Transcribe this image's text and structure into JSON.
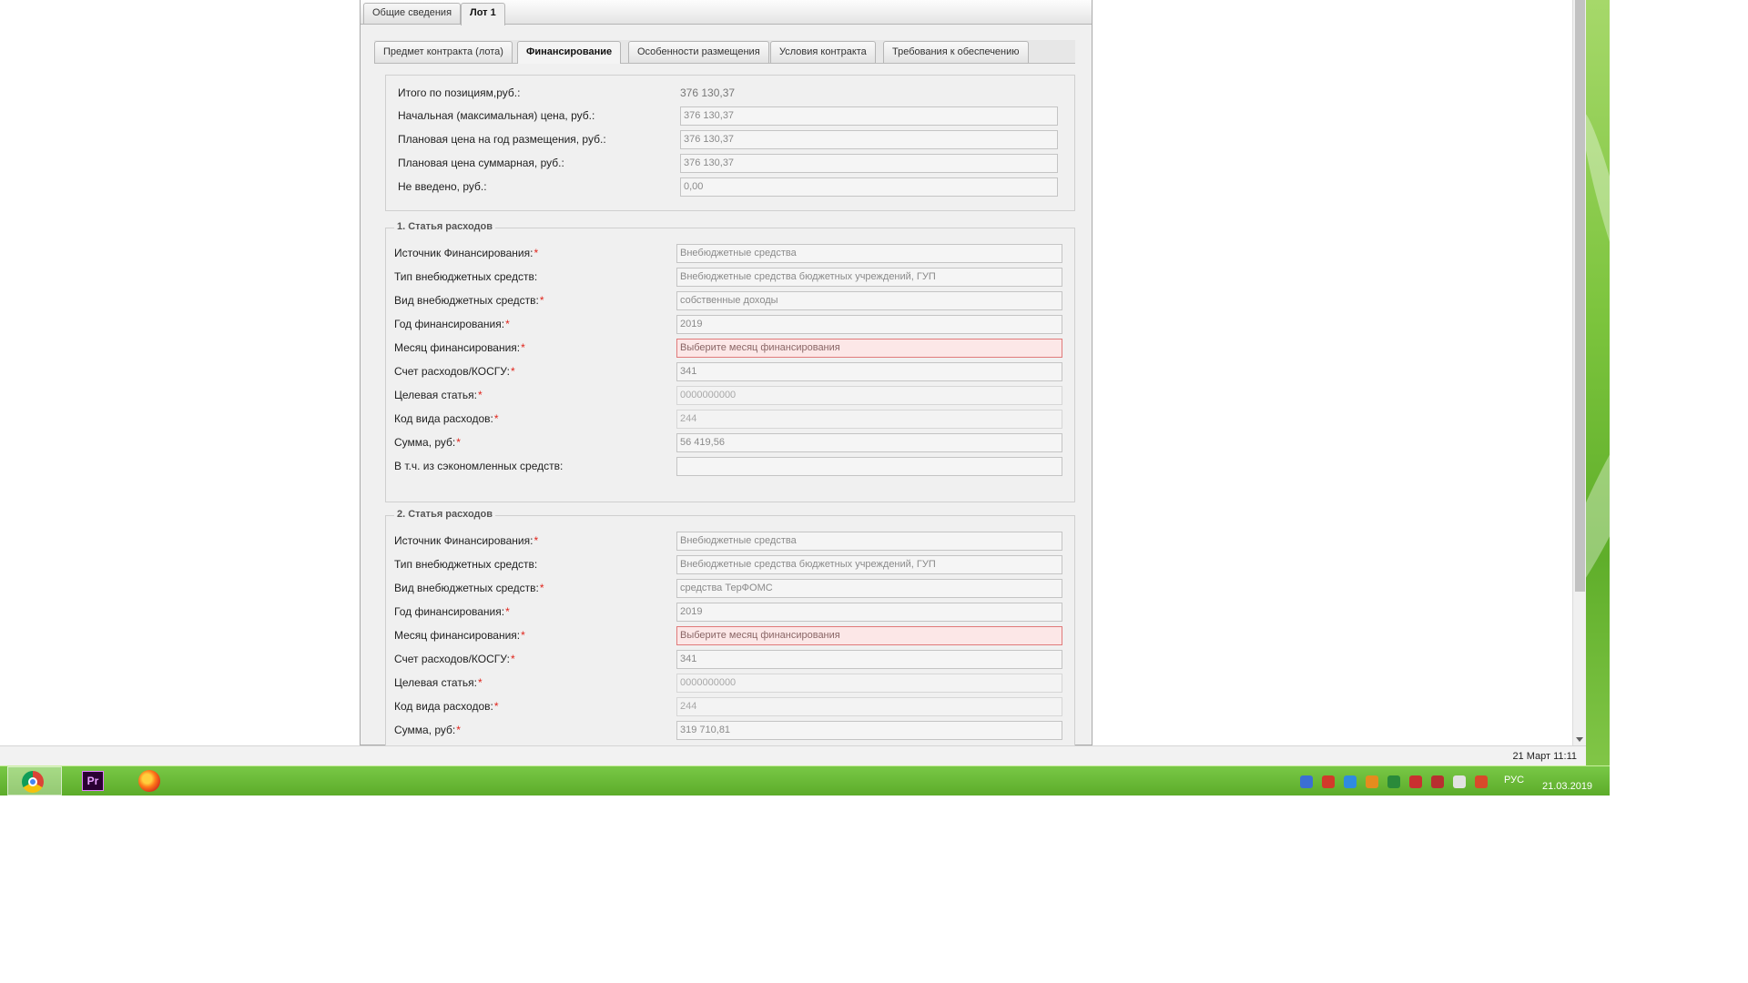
{
  "main_tabs": [
    "Общие сведения",
    "Лот 1"
  ],
  "sub_tabs": [
    "Предмет контракта (лота)",
    "Финансирование",
    "Особенности размещения",
    "Условия контракта",
    "Требования к обеспечению"
  ],
  "summary": {
    "total_label": "Итого по позициям,руб.:",
    "total_value": "376 130,37",
    "initial_label": "Начальная (максимальная) цена, руб.:",
    "initial_value": "376 130,37",
    "planned_year_label": "Плановая цена на год размещения, руб.:",
    "planned_year_value": "376 130,37",
    "planned_total_label": "Плановая цена суммарная, руб.:",
    "planned_total_value": "376 130,37",
    "not_entered_label": "Не введено, руб.:",
    "not_entered_value": "0,00"
  },
  "labels": {
    "source": "Источник Финансирования:",
    "type": "Тип внебюджетных средств:",
    "kind": "Вид внебюджетных средств:",
    "year": "Год финансирования:",
    "month": "Месяц финансирования:",
    "account": "Счет расходов/КОСГУ:",
    "target": "Целевая статья:",
    "expense_code": "Код вида расходов:",
    "sum": "Сумма, руб:",
    "saved": "В т.ч. из сэкономленных средств:",
    "required_mark": "*"
  },
  "expenses": [
    {
      "title": "1. Статья расходов",
      "source": "Внебюджетные средства",
      "type": "Внебюджетные средства бюджетных учреждений, ГУП",
      "kind": "собственные доходы",
      "year": "2019",
      "month": "Выберите месяц финансирования",
      "account": "341",
      "target": "0000000000",
      "expense_code": "244",
      "sum": "56 419,56",
      "saved": ""
    },
    {
      "title": "2. Статья расходов",
      "source": "Внебюджетные средства",
      "type": "Внебюджетные средства бюджетных учреждений, ГУП",
      "kind": "средства ТерФОМС",
      "year": "2019",
      "month": "Выберите месяц финансирования",
      "account": "341",
      "target": "0000000000",
      "expense_code": "244",
      "sum": "319 710,81"
    }
  ],
  "status": {
    "datetime": "21 Март 11:11"
  },
  "taskbar": {
    "lang": "РУС",
    "date": "21.03.2019",
    "premiere_label": "Pr"
  },
  "icons": [
    "chrome-icon",
    "premiere-icon",
    "firefox-icon"
  ]
}
